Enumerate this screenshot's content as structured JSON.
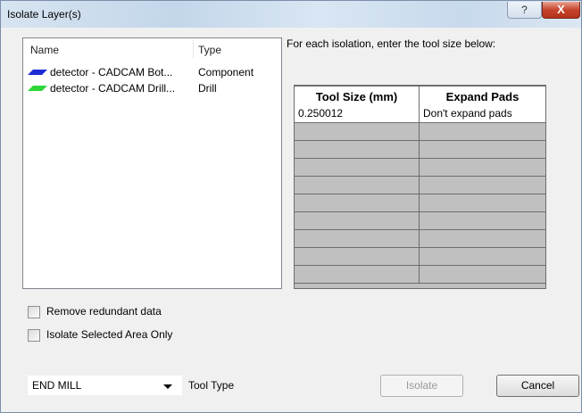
{
  "window": {
    "title": "Isolate Layer(s)",
    "help_label": "?",
    "close_label": "X"
  },
  "layer_list": {
    "columns": {
      "name": "Name",
      "type": "Type"
    },
    "rows": [
      {
        "name": "detector - CADCAM Bot...",
        "type": "Component",
        "color": "#1d2cd6"
      },
      {
        "name": "detector - CADCAM Drill...",
        "type": "Drill",
        "color": "#2fd63a"
      }
    ]
  },
  "instructions": "For each isolation, enter the tool size below:",
  "tool_grid": {
    "columns": {
      "size": "Tool Size (mm)",
      "expand": "Expand Pads"
    },
    "rows": [
      {
        "size": "0.250012",
        "expand": "Don't expand pads"
      },
      {
        "size": "",
        "expand": ""
      },
      {
        "size": "",
        "expand": ""
      },
      {
        "size": "",
        "expand": ""
      },
      {
        "size": "",
        "expand": ""
      },
      {
        "size": "",
        "expand": ""
      },
      {
        "size": "",
        "expand": ""
      },
      {
        "size": "",
        "expand": ""
      },
      {
        "size": "",
        "expand": ""
      },
      {
        "size": "",
        "expand": ""
      }
    ]
  },
  "options": {
    "remove_redundant": {
      "label": "Remove redundant data",
      "checked": false
    },
    "isolate_selected": {
      "label": "Isolate Selected Area Only",
      "checked": false
    }
  },
  "tool_type": {
    "value": "END MILL",
    "label": "Tool Type"
  },
  "buttons": {
    "isolate": "Isolate",
    "cancel": "Cancel"
  }
}
